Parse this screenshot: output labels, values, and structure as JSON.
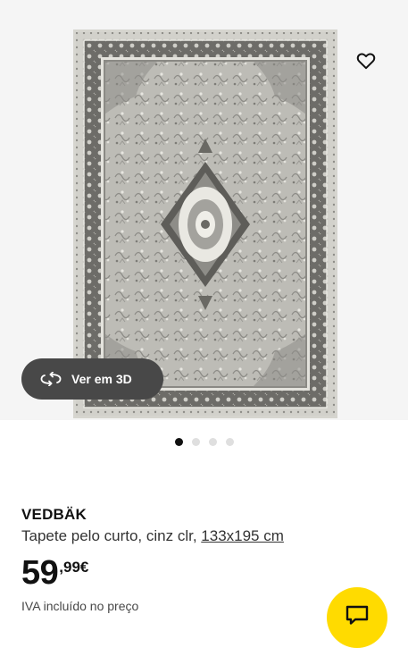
{
  "gallery": {
    "image_alt": "Tapete VEDBÄK cinzento com padrão oriental",
    "favorite_icon": "heart-outline-icon",
    "view_3d": {
      "label": "Ver em 3D",
      "icon": "rotate-3d-icon"
    },
    "dots": {
      "count": 4,
      "active_index": 0
    }
  },
  "product": {
    "name": "VEDBÄK",
    "description": "Tapete pelo curto, cinz clr,",
    "size": "133x195 cm",
    "price": {
      "integer": "59",
      "decimal": ",99€"
    },
    "vat_note": "IVA incluído no preço"
  },
  "chat_button": {
    "icon": "chat-icon"
  },
  "colors": {
    "accent_yellow": "#ffdb00",
    "button_dark": "#484848",
    "rug_field": "#b9b8b2",
    "rug_border": "#6f6e6a",
    "rug_light": "#ecebe5"
  }
}
